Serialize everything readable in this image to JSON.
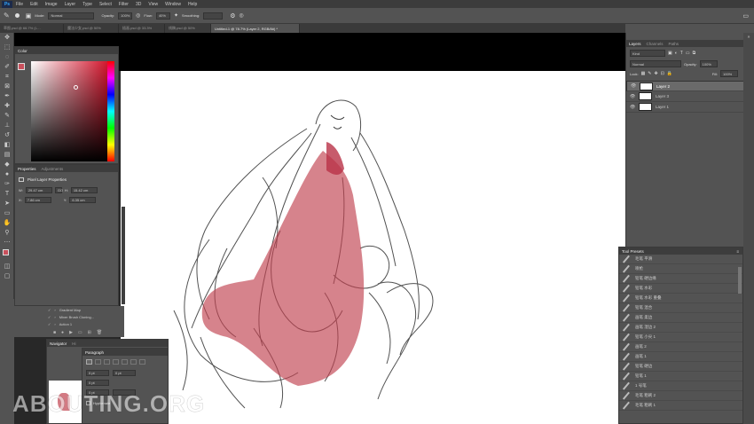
{
  "menu": {
    "app": "Ps",
    "items": [
      "File",
      "Edit",
      "Image",
      "Layer",
      "Type",
      "Select",
      "Filter",
      "3D",
      "View",
      "Window",
      "Help"
    ]
  },
  "options": {
    "mode_label": "Mode:",
    "mode_value": "Normal",
    "opacity_label": "Opacity:",
    "opacity_value": "100%",
    "flow_label": "Flow:",
    "flow_value": "40%",
    "smoothing_label": "Smoothing:"
  },
  "tabs": [
    "草图.psd @ 66.7% (L…",
    "魔法少女.psd @ 50%",
    "插画.psd @ 33.3%",
    "线稿.psd @ 50%",
    "Untitled-1 @ 78.7% (Layer 2, RGB/8#) *"
  ],
  "color_panel": {
    "title": "Color",
    "fg": "#c9505c",
    "bg": "#ffffff"
  },
  "properties": {
    "tab1": "Properties",
    "tab2": "Adjustments",
    "heading": "Pixel Layer Properties",
    "w_label": "W:",
    "w_value": "29.47 cm",
    "h_label": "H:",
    "h_value": "15.42 cm",
    "x_label": "X:",
    "x_value": "7.86 cm",
    "y_label": "Y:",
    "y_value": "6.35 cm",
    "go_label": "GO"
  },
  "small_layers": [
    "Gradient Map",
    "Mixer Brush Cloning...",
    "Action 1"
  ],
  "navigator": {
    "tab1": "Navigator",
    "tab2": "Hi"
  },
  "paragraph": {
    "title": "Paragraph",
    "f1": "0 pt",
    "f2": "0 pt",
    "f3": "0 pt",
    "f4": "0 pt",
    "hyphenate": "Hyphenate"
  },
  "layers_panel": {
    "tabs": [
      "Layers",
      "Channels",
      "Paths"
    ],
    "kind": "Kind",
    "blend": "Normal",
    "opacity_label": "Opacity:",
    "opacity_value": "100%",
    "lock_label": "Lock:",
    "fill_label": "Fill:",
    "fill_value": "100%",
    "layers": [
      {
        "name": "Layer 2",
        "selected": true
      },
      {
        "name": "Layer 3",
        "selected": false
      },
      {
        "name": "Layer 1",
        "selected": false
      }
    ]
  },
  "tool_presets": {
    "title": "Tool Presets",
    "items": [
      "毛笔 平滑",
      "喷枪",
      "铅笔 硬边缘",
      "铅笔 水彩",
      "铅笔 水彩 重叠",
      "铅笔 混合",
      "画笔 柔边",
      "画笔 湿边 2",
      "铅笔 小尖 1",
      "画笔 2",
      "画笔 1",
      "铅笔 硬边",
      "铅笔 1",
      "1 号笔",
      "毛笔 粗刷 2",
      "毛笔 粗刷 1"
    ]
  },
  "watermark": "ABOUTING.ORG"
}
